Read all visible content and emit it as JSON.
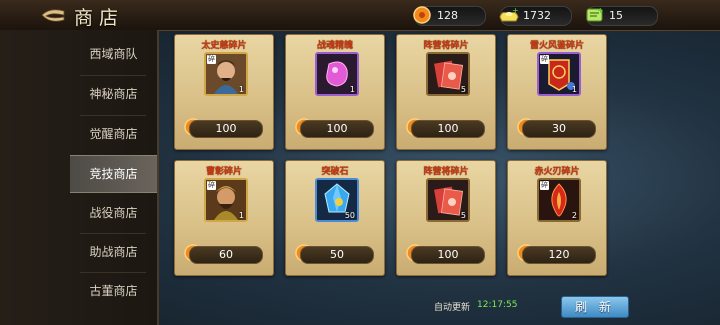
{
  "header": {
    "title": "商店",
    "resources": [
      {
        "icon": "orange-coin-icon",
        "value": "128"
      },
      {
        "icon": "gold-ingot-icon",
        "value": "1732"
      },
      {
        "icon": "green-ticket-icon",
        "value": "15"
      }
    ]
  },
  "sidebar": {
    "items": [
      {
        "label": "西域商队"
      },
      {
        "label": "神秘商店"
      },
      {
        "label": "觉醒商店"
      },
      {
        "label": "竞技商店"
      },
      {
        "label": "战役商店"
      },
      {
        "label": "助战商店"
      },
      {
        "label": "古董商店"
      }
    ],
    "active_index": 3
  },
  "shop_items": [
    {
      "name": "太史慈碎片",
      "icon": "general-portrait-icon",
      "quantity": "1",
      "price": "100",
      "fragment": "碎"
    },
    {
      "name": "战魂精魄",
      "icon": "purple-soul-stone-icon",
      "quantity": "1",
      "price": "100"
    },
    {
      "name": "阵营将碎片",
      "icon": "red-scroll-icon",
      "quantity": "5",
      "price": "100"
    },
    {
      "name": "雷火风鉴碎片",
      "icon": "red-badge-icon",
      "quantity": "1",
      "price": "30",
      "fragment": "碎"
    },
    {
      "name": "曹彰碎片",
      "icon": "general-portrait-icon",
      "quantity": "1",
      "price": "60",
      "fragment": "碎"
    },
    {
      "name": "突破石",
      "icon": "blue-crystal-icon",
      "quantity": "50",
      "price": "50"
    },
    {
      "name": "阵营将碎片",
      "icon": "red-scroll-icon",
      "quantity": "5",
      "price": "100"
    },
    {
      "name": "赤火刃碎片",
      "icon": "red-flame-blade-icon",
      "quantity": "2",
      "price": "120",
      "fragment": "碎"
    }
  ],
  "footer": {
    "auto_refresh_label": "自动更新",
    "auto_refresh_time": "12:17:55",
    "refresh_button": "刷 新"
  }
}
